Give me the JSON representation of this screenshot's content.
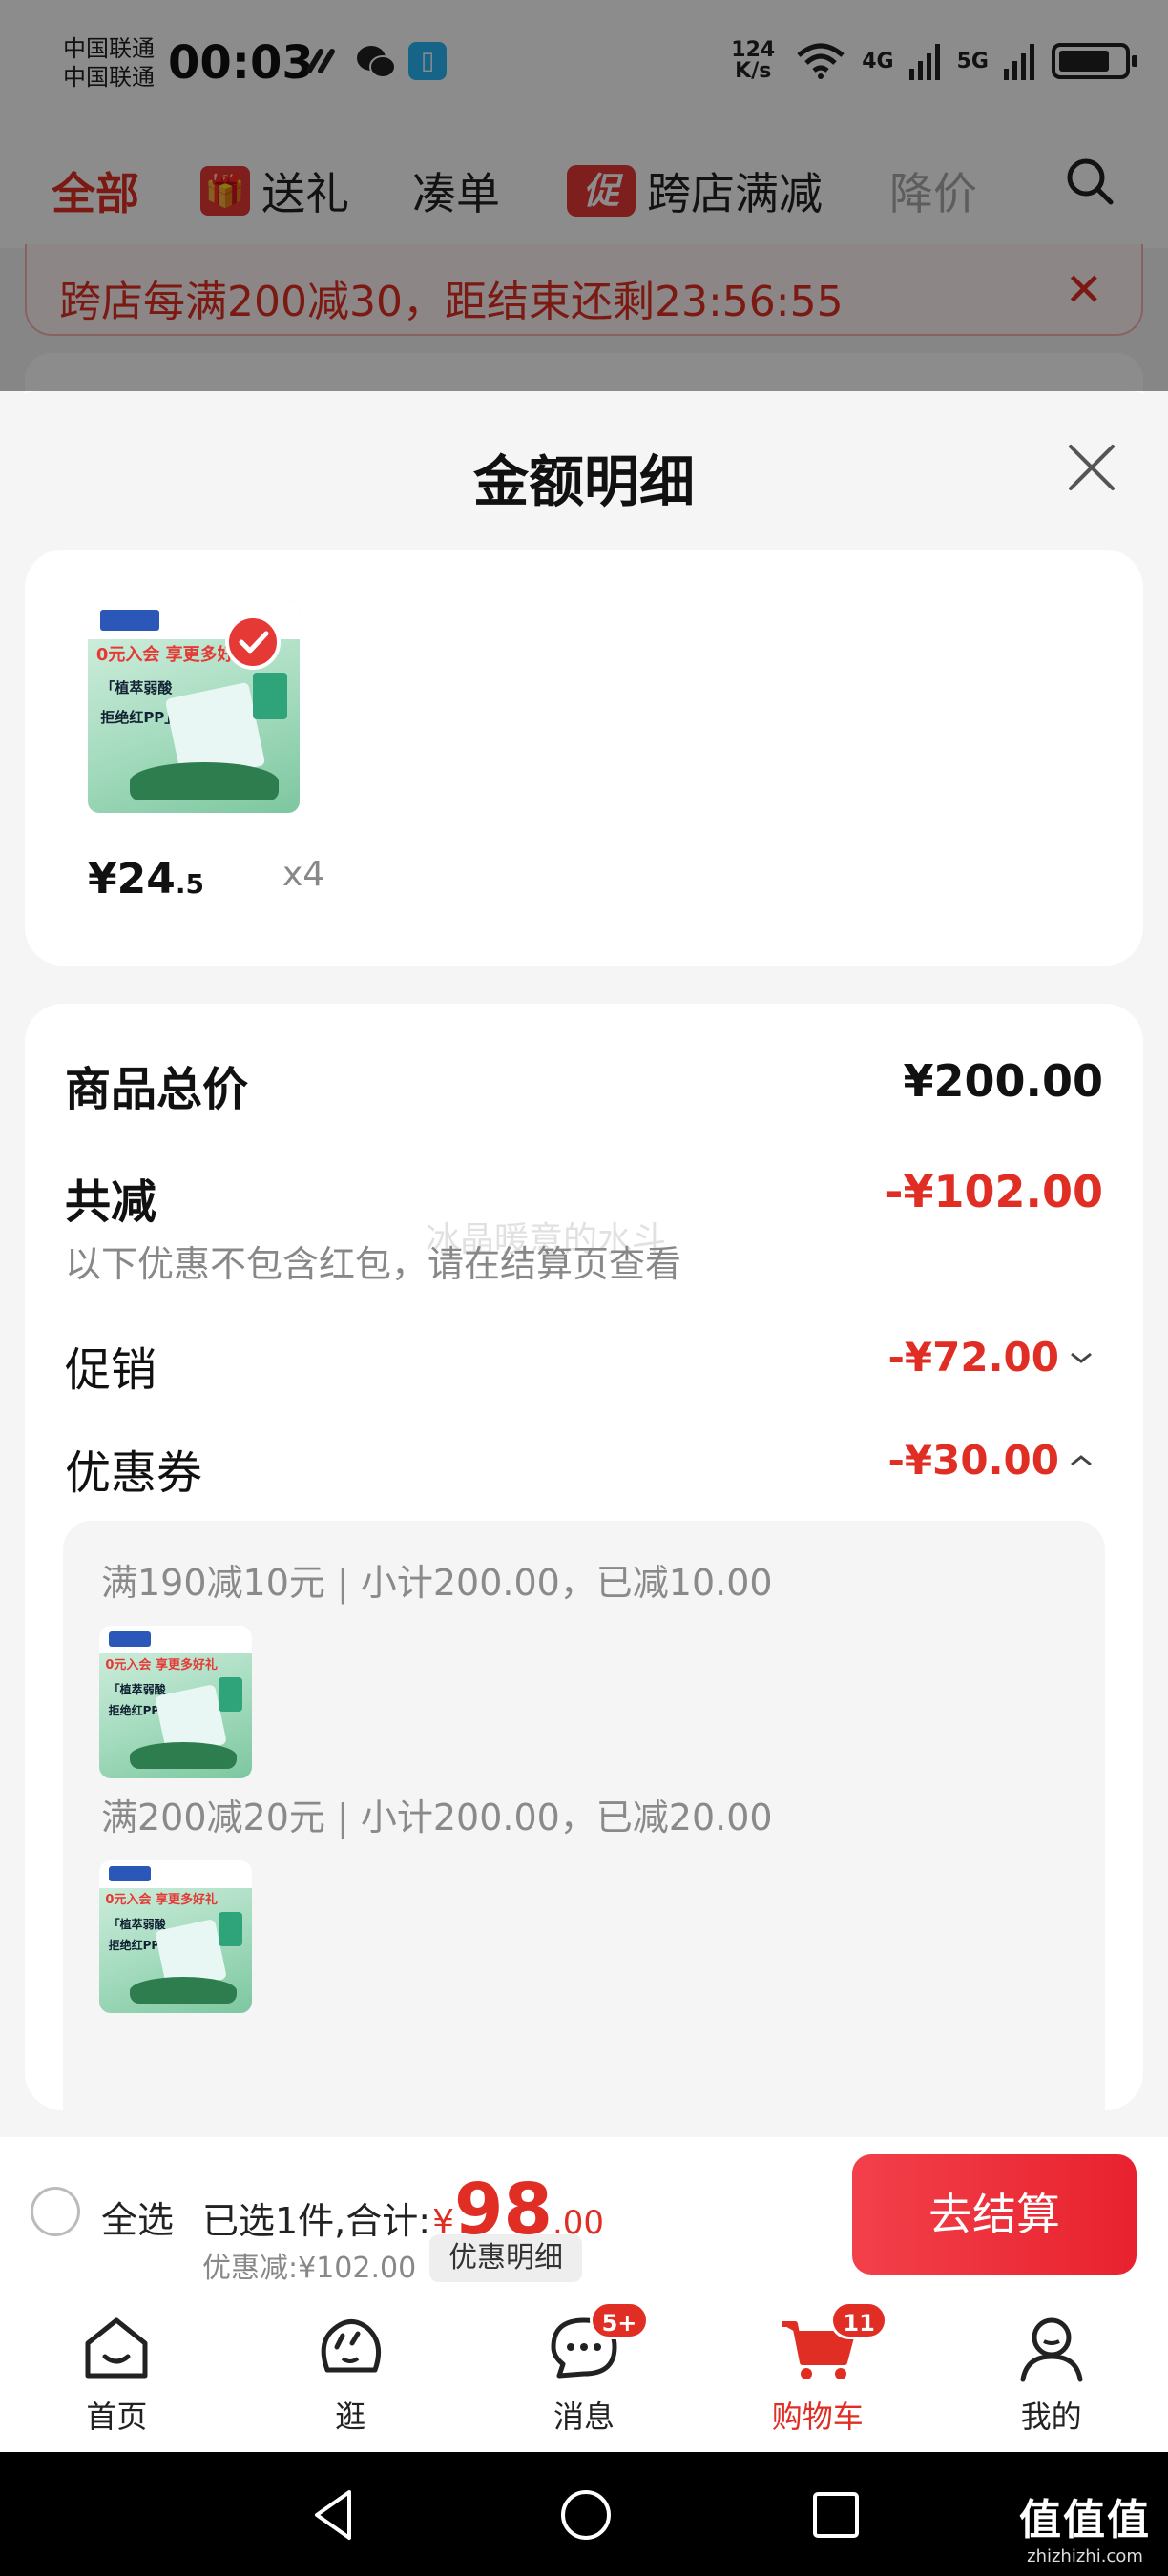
{
  "status_bar": {
    "carrier_1": "中国联通",
    "carrier_2": "中国联通",
    "time": "00:03",
    "net_speed_value": "124",
    "net_speed_unit": "K/s",
    "sig_4g": "4G",
    "sig_5g": "5G",
    "icons": [
      "link-icon",
      "wechat-icon",
      "reader-app-icon",
      "wifi-icon",
      "signal-4g-icon",
      "signal-5g-icon",
      "battery-icon"
    ]
  },
  "top_tabs": [
    {
      "label": "全部",
      "active": true
    },
    {
      "label": "送礼",
      "icon": "gift-icon"
    },
    {
      "label": "凑单"
    },
    {
      "label": "跨店满减",
      "badge": "促"
    },
    {
      "label": "降价",
      "muted": true
    }
  ],
  "promo_banner": {
    "text": "跨店每满200减30，距结束还剩23:56:55",
    "close": "✕"
  },
  "sheet": {
    "title": "金额明细",
    "product": {
      "thumb_promo": "0元入会 享更多好礼",
      "thumb_line1": "「植萃弱酸",
      "thumb_line2": "拒绝红PP」",
      "price_symbol": "¥",
      "price_int": "24",
      "price_dec": ".5",
      "quantity": "x4"
    },
    "summary": {
      "total_label": "商品总价",
      "total_value": "¥200.00",
      "reduce_label": "共减",
      "reduce_value": "-¥102.00",
      "reduce_note": "以下优惠不包含红包，请在结算页查看",
      "watermark": "冰晶暖意的水斗",
      "promo_label": "促销",
      "promo_value": "-¥72.00",
      "coupon_label": "优惠券",
      "coupon_value": "-¥30.00"
    },
    "coupons": [
      {
        "text": "满190减10元 | 小计200.00，已减10.00"
      },
      {
        "text": "满200减20元 | 小计200.00，已减20.00"
      }
    ]
  },
  "checkout": {
    "select_all": "全选",
    "summary_prefix": "已选1件,合计:",
    "yen": "¥",
    "total_int": "98",
    "total_dec": ".00",
    "discount": "优惠减:¥102.00",
    "detail_button": "优惠明细",
    "checkout_button": "去结算"
  },
  "bottom_nav": [
    {
      "label": "首页",
      "icon": "home-icon"
    },
    {
      "label": "逛",
      "icon": "browse-icon"
    },
    {
      "label": "消息",
      "icon": "message-icon",
      "badge": "5+"
    },
    {
      "label": "购物车",
      "icon": "cart-icon",
      "badge": "11",
      "active": true
    },
    {
      "label": "我的",
      "icon": "profile-icon"
    }
  ],
  "watermark_corner": {
    "logo": "值值值",
    "domain": "zhizhizhi.com"
  },
  "colors": {
    "accent_red": "#e02e24",
    "button_red": "#f2404a",
    "text_gray": "#888888",
    "panel_bg": "#f5f5f5"
  }
}
